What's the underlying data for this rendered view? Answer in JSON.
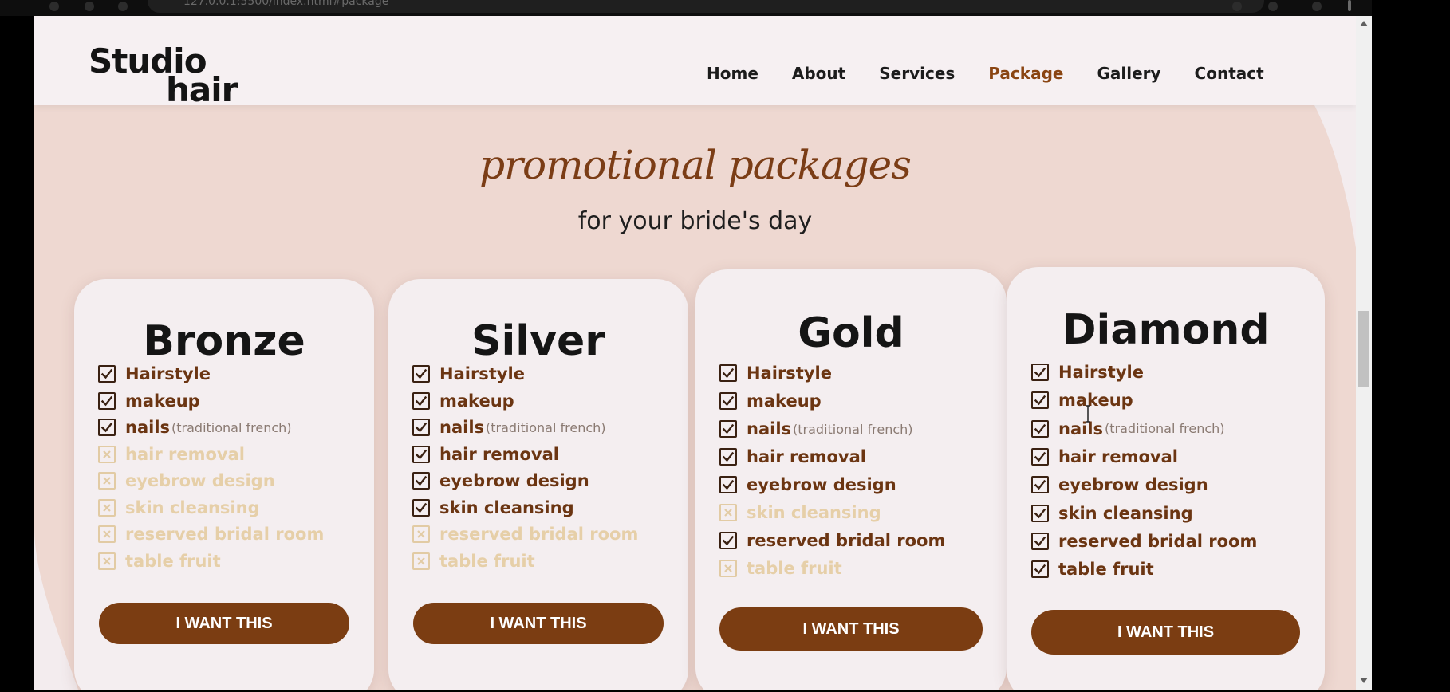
{
  "browser": {
    "url_fragment": "127.0.0.1:5500/index.html#package"
  },
  "header": {
    "logo_line1": "Studio",
    "logo_line2": "hair",
    "nav": [
      {
        "label": "Home",
        "active": false
      },
      {
        "label": "About",
        "active": false
      },
      {
        "label": "Services",
        "active": false
      },
      {
        "label": "Package",
        "active": true
      },
      {
        "label": "Gallery",
        "active": false
      },
      {
        "label": "Contact",
        "active": false
      }
    ]
  },
  "hero": {
    "title": "promotional packages",
    "subtitle": "for your bride's day"
  },
  "packages": [
    {
      "name": "Bronze",
      "features": [
        {
          "label": "Hairstyle",
          "included": true
        },
        {
          "label": "makeup",
          "included": true
        },
        {
          "label": "nails",
          "note": "(traditional french)",
          "included": true
        },
        {
          "label": "hair removal",
          "included": false
        },
        {
          "label": "eyebrow design",
          "included": false
        },
        {
          "label": "skin cleansing",
          "included": false
        },
        {
          "label": "reserved bridal room",
          "included": false
        },
        {
          "label": "table fruit",
          "included": false
        }
      ],
      "button": "I WANT THIS"
    },
    {
      "name": "Silver",
      "features": [
        {
          "label": "Hairstyle",
          "included": true
        },
        {
          "label": "makeup",
          "included": true
        },
        {
          "label": "nails",
          "note": "(traditional french)",
          "included": true
        },
        {
          "label": "hair removal",
          "included": true
        },
        {
          "label": "eyebrow design",
          "included": true
        },
        {
          "label": "skin cleansing",
          "included": true
        },
        {
          "label": "reserved bridal room",
          "included": false
        },
        {
          "label": "table fruit",
          "included": false
        }
      ],
      "button": "I WANT THIS"
    },
    {
      "name": "Gold",
      "features": [
        {
          "label": "Hairstyle",
          "included": true
        },
        {
          "label": "makeup",
          "included": true
        },
        {
          "label": "nails",
          "note": "(traditional french)",
          "included": true
        },
        {
          "label": "hair removal",
          "included": true
        },
        {
          "label": "eyebrow design",
          "included": true
        },
        {
          "label": "skin cleansing",
          "included": false
        },
        {
          "label": "reserved bridal room",
          "included": true
        },
        {
          "label": "table fruit",
          "included": false
        }
      ],
      "button": "I WANT THIS"
    },
    {
      "name": "Diamond",
      "features": [
        {
          "label": "Hairstyle",
          "included": true
        },
        {
          "label": "makeup",
          "included": true
        },
        {
          "label": "nails",
          "note": "(traditional french)",
          "included": true
        },
        {
          "label": "hair removal",
          "included": true
        },
        {
          "label": "eyebrow design",
          "included": true
        },
        {
          "label": "skin cleansing",
          "included": true
        },
        {
          "label": "reserved bridal room",
          "included": true
        },
        {
          "label": "table fruit",
          "included": true
        }
      ],
      "button": "I WANT THIS"
    }
  ],
  "colors": {
    "accent": "#8a4512",
    "button": "#7b3d12",
    "hero_blob": "#eed8d1",
    "page_bg": "#f3ecee",
    "excluded": "#e6cfa8"
  },
  "icons": {
    "included": "checkbox-checked-icon",
    "excluded": "checkbox-crossed-icon"
  }
}
